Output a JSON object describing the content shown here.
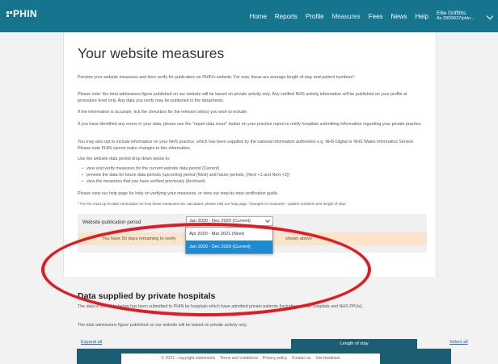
{
  "header": {
    "logo_text": "PHIN",
    "nav": [
      "Home",
      "Reports",
      "Profile",
      "Measures",
      "Fees",
      "News",
      "Help"
    ],
    "active_nav": "Measures",
    "user_name": "Ellie Griffiths",
    "user_sub": "As 29D9637/phin..."
  },
  "page": {
    "title": "Your website measures",
    "paragraphs": [
      "Preview your website measures and then verify for publication on PHIN's website. For now, these are average length of stay and patient numbers*.",
      "Please note: the total admissions figure published on our website will be based on private activity only. Any verified NHS activity information will be published on your profile at procedure level only. Any data you verify may be published in the datasheets.",
      "If the information is accurate, tick the checkbox for the relevant site(s) you wish to include.",
      "If you have identified any errors in your data, please use the \"report data issue\" button on your practice report to notify hospitals submitting information regarding your private practice.",
      "You may also opt to include information on your NHS practice, which has been supplied by the national information authorities e.g. NHS Digital or NHS Wales Informatics Service. Please note PHIN cannot make changes to this information.",
      "Use the website data period drop down below to:"
    ],
    "bullets": [
      "view and verify measures for the current website data period (Current)",
      "preview the data for future data periods (upcoming period (Next) and future periods, (Next +1 and Next +2))",
      "view the measures that you have verified previously (Archived)"
    ],
    "help_text": "Please view our help page for help on verifying your measures, or view our step-by-step verification guide.",
    "note_text": "* For the most up-to-date information on how these measures are calculated, please visit our help page \"changes to measures - patient numbers and length of stay\""
  },
  "period": {
    "label": "Website publication period",
    "selected": "Jan 2020 - Dec 2020 (Current)",
    "options": [
      "Apr 2020 - Mar 2021 (Next)",
      "Jan 2020 - Dec 2020 (Current)"
    ],
    "warning_left": "You have 50 days remaining to verify",
    "warning_right": "shown above"
  },
  "private": {
    "title": "Data supplied by private hospitals",
    "para1": "The data in the table below has been submitted to PHIN by hospitals which have admitted private patients (including private hospitals and NHS PPUs).",
    "para2": "The total admissions figure published on our website will be based on private activity only.",
    "expand_all": "Expand all",
    "select_all": "Select all",
    "length_of_stay": "Length of stay"
  },
  "footer": {
    "items": [
      "© 2021 - copyright statements",
      "Terms and conditions",
      "Privacy policy",
      "Contact us",
      "Site feedback"
    ]
  },
  "colors": {
    "topbar": "#16748f",
    "annotation": "#e11b22",
    "selected_option": "#1e8ad2",
    "warning_bg": "#fbe4c9"
  }
}
